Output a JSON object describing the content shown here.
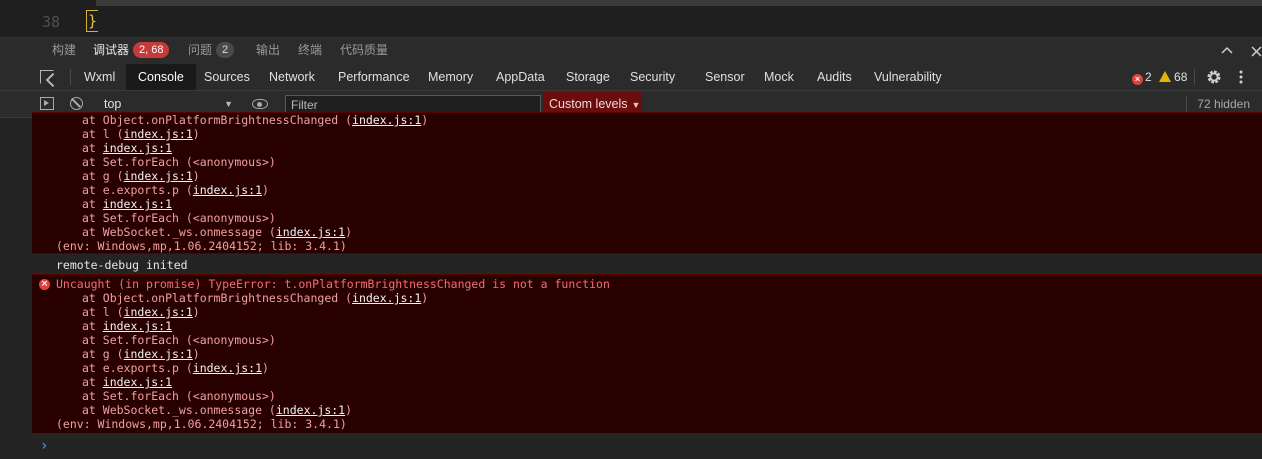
{
  "editor": {
    "line_number": "38",
    "code": "}"
  },
  "panel_tabs": [
    {
      "label": "构建"
    },
    {
      "label": "调试器",
      "badge": "2, 68"
    },
    {
      "label": "问题",
      "badge": "2"
    },
    {
      "label": "输出"
    },
    {
      "label": "终端"
    },
    {
      "label": "代码质量"
    }
  ],
  "devtools_tabs": [
    "Wxml",
    "Console",
    "Sources",
    "Network",
    "Performance",
    "Memory",
    "AppData",
    "Storage",
    "Security",
    "Sensor",
    "Mock",
    "Audits",
    "Vulnerability"
  ],
  "counts": {
    "errors": "2",
    "warnings": "68"
  },
  "toolbar": {
    "context": "top",
    "filter_placeholder": "Filter",
    "levels": "Custom levels",
    "hidden": "72 hidden"
  },
  "messages": {
    "first_trace": [
      {
        "pre": "at Object.onPlatformBrightnessChanged (",
        "link": "index.js:1",
        "post": ")"
      },
      {
        "pre": "at l (",
        "link": "index.js:1",
        "post": ")"
      },
      {
        "pre": "at ",
        "link": "index.js:1",
        "post": ""
      },
      {
        "pre": "at Set.forEach (<anonymous>)",
        "link": "",
        "post": ""
      },
      {
        "pre": "at g (",
        "link": "index.js:1",
        "post": ")"
      },
      {
        "pre": "at e.exports.p (",
        "link": "index.js:1",
        "post": ")"
      },
      {
        "pre": "at ",
        "link": "index.js:1",
        "post": ""
      },
      {
        "pre": "at Set.forEach (<anonymous>)",
        "link": "",
        "post": ""
      },
      {
        "pre": "at WebSocket._ws.onmessage (",
        "link": "index.js:1",
        "post": ")"
      }
    ],
    "env": "(env: Windows,mp,1.06.2404152; lib: 3.4.1)",
    "info": "remote-debug inited",
    "error_head": "Uncaught (in promise) TypeError: t.onPlatformBrightnessChanged is not a function",
    "second_trace": [
      {
        "pre": "at Object.onPlatformBrightnessChanged (",
        "link": "index.js:1",
        "post": ")"
      },
      {
        "pre": "at l (",
        "link": "index.js:1",
        "post": ")"
      },
      {
        "pre": "at ",
        "link": "index.js:1",
        "post": ""
      },
      {
        "pre": "at Set.forEach (<anonymous>)",
        "link": "",
        "post": ""
      },
      {
        "pre": "at g (",
        "link": "index.js:1",
        "post": ")"
      },
      {
        "pre": "at e.exports.p (",
        "link": "index.js:1",
        "post": ")"
      },
      {
        "pre": "at ",
        "link": "index.js:1",
        "post": ""
      },
      {
        "pre": "at Set.forEach (<anonymous>)",
        "link": "",
        "post": ""
      },
      {
        "pre": "at WebSocket._ws.onmessage (",
        "link": "index.js:1",
        "post": ")"
      }
    ],
    "env2": "(env: Windows,mp,1.06.2404152; lib: 3.4.1)"
  },
  "prompt_symbol": "›",
  "icons": {
    "inspect": "inspect-element-icon",
    "sidebar": "sidebar-toggle-icon",
    "clear": "clear-console-icon",
    "eye": "live-expression-icon",
    "settings": "gear-icon",
    "more": "more-vertical-icon"
  },
  "colors": {
    "error_bg": "#290000",
    "error_text": "#f08f8f",
    "levels_bg": "#6b0d0d",
    "badge_red": "#c53a3a"
  }
}
